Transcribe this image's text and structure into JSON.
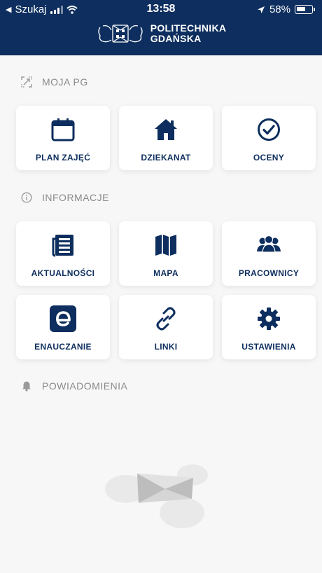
{
  "status_bar": {
    "carrier": "Szukaj",
    "time": "13:58",
    "battery": "58%"
  },
  "header": {
    "brand_line1": "POLITECHNIKA",
    "brand_line2": "GDAŃSKA"
  },
  "sections": {
    "moja_pg": {
      "title": "MOJA PG",
      "icon": "resize-icon"
    },
    "informacje": {
      "title": "INFORMACJE",
      "icon": "info-icon"
    },
    "powiadomienia": {
      "title": "POWIADOMIENIA",
      "icon": "bell-icon"
    }
  },
  "tiles": {
    "plan": {
      "label": "PLAN ZAJĘĆ",
      "icon": "calendar-icon"
    },
    "dziekanat": {
      "label": "DZIEKANAT",
      "icon": "home-icon"
    },
    "oceny": {
      "label": "OCENY",
      "icon": "check-circle-icon"
    },
    "aktualnosci": {
      "label": "AKTUALNOŚCI",
      "icon": "news-icon"
    },
    "mapa": {
      "label": "MAPA",
      "icon": "map-icon"
    },
    "pracownicy": {
      "label": "PRACOWNICY",
      "icon": "people-icon"
    },
    "enauczanie": {
      "label": "ENAUCZANIE",
      "icon": "e-icon"
    },
    "linki": {
      "label": "LINKI",
      "icon": "link-icon"
    },
    "ustawienia": {
      "label": "USTAWIENIA",
      "icon": "gear-icon"
    }
  },
  "colors": {
    "header_bg": "#0d2e5e",
    "tile_text": "#0d2e5e",
    "page_bg": "#f7f7f7"
  }
}
